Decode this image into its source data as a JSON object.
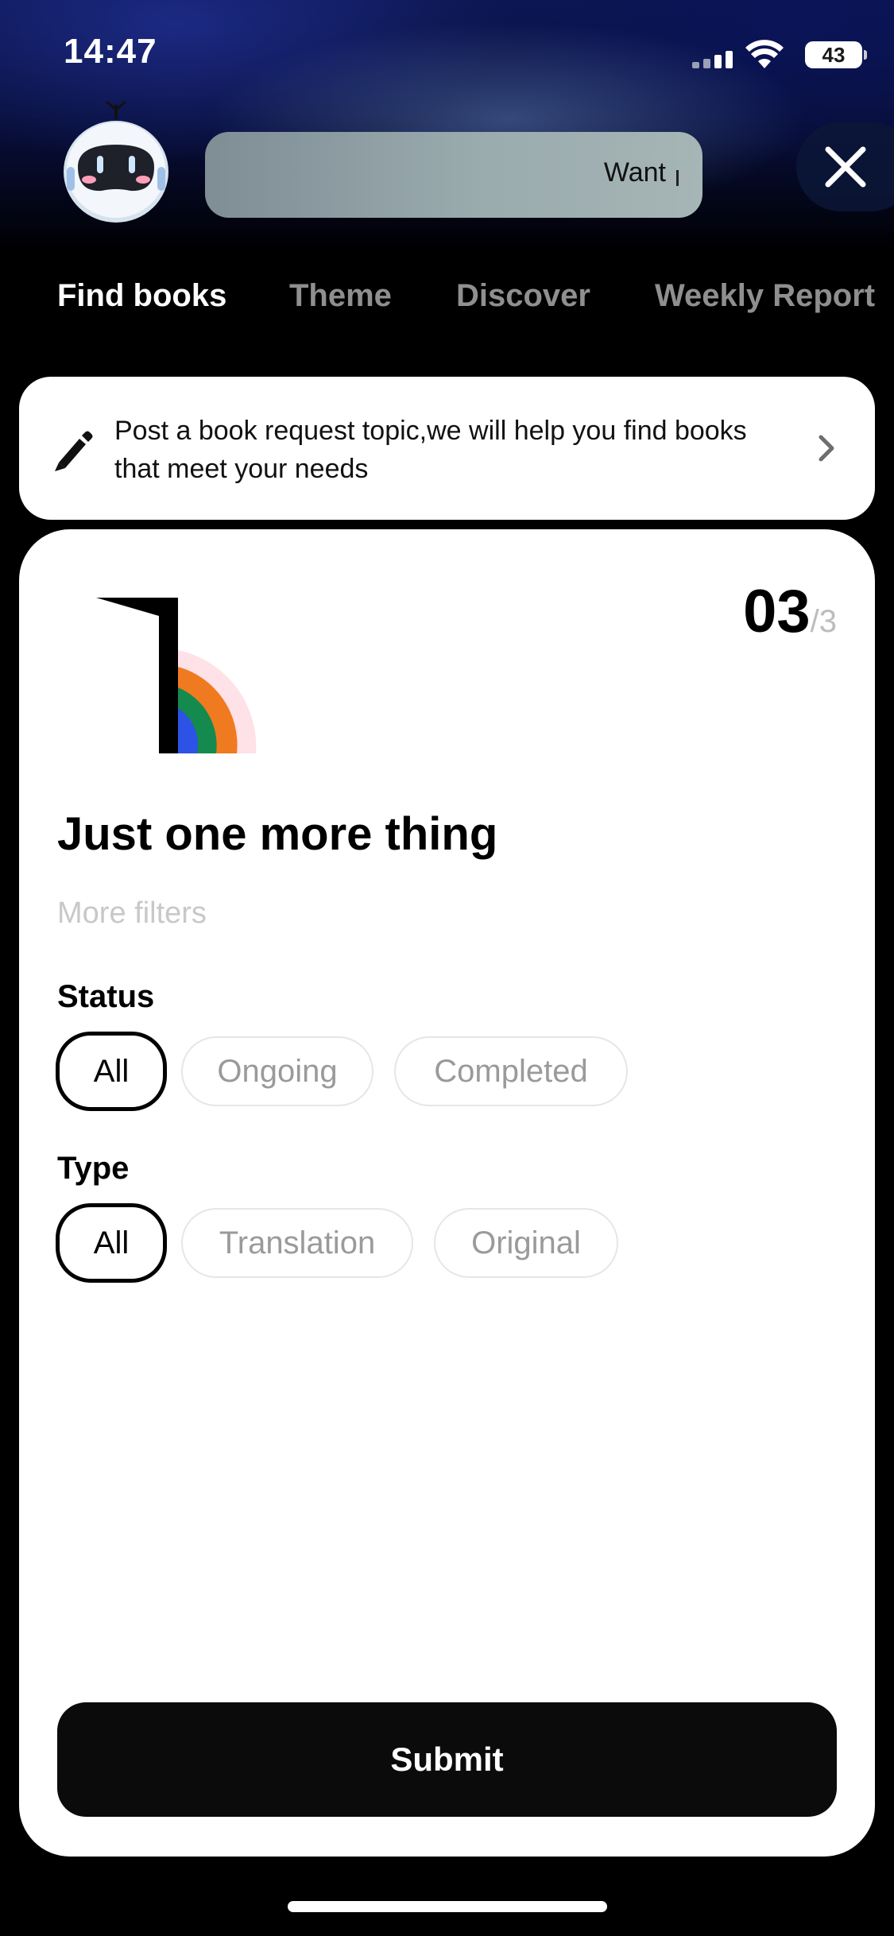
{
  "status_bar": {
    "time": "14:47",
    "battery": "43",
    "icons": [
      "signal-icon",
      "wifi-icon",
      "battery-icon"
    ]
  },
  "header": {
    "avatar_icon": "robot-icon",
    "prompt_text": "Want",
    "close_icon": "close-icon"
  },
  "tabs": [
    {
      "label": "Find books",
      "active": true
    },
    {
      "label": "Theme",
      "active": false
    },
    {
      "label": "Discover",
      "active": false
    },
    {
      "label": "Weekly Report",
      "active": false
    }
  ],
  "request_card": {
    "icon": "pencil-icon",
    "text": "Post a book request topic,we will help you find books that meet your needs",
    "chevron_icon": "chevron-right-icon"
  },
  "filters_card": {
    "step_current": "03",
    "step_total": "/3",
    "title": "Just one more thing",
    "subtitle": "More filters",
    "status": {
      "label": "Status",
      "options": [
        "All",
        "Ongoing",
        "Completed"
      ],
      "selected": "All"
    },
    "type": {
      "label": "Type",
      "options": [
        "All",
        "Translation",
        "Original"
      ],
      "selected": "All"
    },
    "submit_label": "Submit"
  },
  "colors": {
    "accent": "#000000",
    "background": "#000000",
    "card": "#ffffff",
    "chip_border": "#e6e6e6",
    "muted_text": "#9a9a9a"
  }
}
